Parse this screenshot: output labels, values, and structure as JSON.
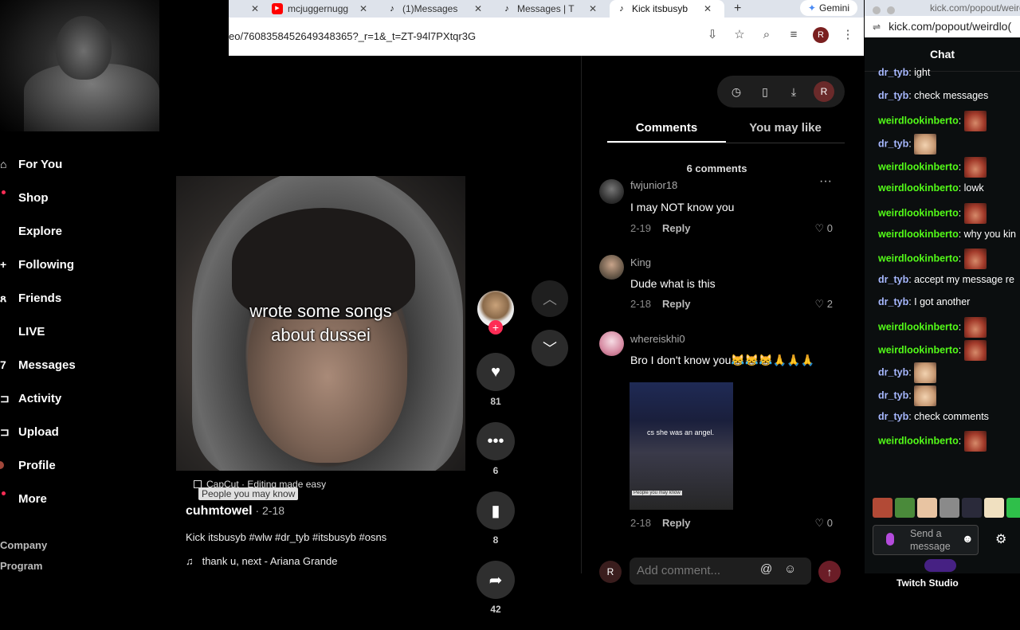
{
  "browser": {
    "tabs": [
      {
        "title": "mcjuggernugg",
        "icon": "youtube-icon"
      },
      {
        "title": "(1)Messages",
        "icon": "tiktok-icon"
      },
      {
        "title": "Messages | T",
        "icon": "tiktok-icon"
      },
      {
        "title": "Kick itsbusyb",
        "icon": "tiktok-icon",
        "active": true
      }
    ],
    "new_tab": "+",
    "gemini_label": "Gemini",
    "url": "eo/7608358452649348365?_r=1&_t=ZT-94l7PXtqr3G",
    "profile_initial": "R"
  },
  "nav": {
    "items": [
      {
        "label": "For You",
        "icon": "home-icon"
      },
      {
        "label": "Shop",
        "icon": "shop-icon",
        "dot": true
      },
      {
        "label": "Explore",
        "icon": "explore-icon"
      },
      {
        "label": "Following",
        "icon": "following-icon"
      },
      {
        "label": "Friends",
        "icon": "friends-icon"
      },
      {
        "label": "LIVE",
        "icon": "live-icon"
      },
      {
        "label": "Messages",
        "icon": "messages-icon"
      },
      {
        "label": "Activity",
        "icon": "activity-icon"
      },
      {
        "label": "Upload",
        "icon": "upload-icon"
      },
      {
        "label": "Profile",
        "icon": "profile-avatar"
      },
      {
        "label": "More",
        "icon": "more-icon",
        "dot": true
      }
    ],
    "footer": [
      "Company",
      "Program"
    ]
  },
  "video": {
    "caption_line1": "wrote some songs",
    "caption_line2": "about dussei",
    "capcut": "CapCut · Editing made easy",
    "people_you_may_know": "People you may know",
    "author": "cuhmtowel",
    "date": " · 2-18",
    "description": "Kick itsbusyb #wlw #dr_tyb #itsbusyb #osns",
    "music": "thank u, next - Ariana Grande"
  },
  "actions": {
    "likes": "81",
    "comments": "6",
    "saves": "8",
    "shares": "42"
  },
  "panel": {
    "tabs": [
      "Comments",
      "You may like"
    ],
    "comment_count": "6 comments",
    "profile_initial": "R",
    "comments": [
      {
        "user": "fwjunior18",
        "text": "I may NOT know you",
        "date": "2-19",
        "reply": "Reply",
        "likes": "0"
      },
      {
        "user": "King",
        "text": "Dude what is this",
        "date": "2-18",
        "reply": "Reply",
        "likes": "2"
      },
      {
        "user": "whereiskhi0",
        "text": "Bro I don't know you😹😹😹🙏🙏🙏",
        "date": "2-18",
        "reply": "Reply",
        "likes": "0",
        "image_caption": "cs she was an angel."
      }
    ],
    "add_comment_placeholder": "Add comment..."
  },
  "kick": {
    "window_title": "kick.com/popout/weirdlo",
    "url": "kick.com/popout/weirdlo(",
    "chat_title": "Chat",
    "messages": [
      {
        "user": "dr_tyb",
        "text": "ight",
        "kind": "tyb"
      },
      {
        "user": "dr_tyb",
        "text": "check messages",
        "kind": "tyb"
      },
      {
        "user": "weirdlookinberto",
        "text": "",
        "kind": "berto",
        "emote": "red"
      },
      {
        "user": "dr_tyb",
        "text": "",
        "kind": "tyb",
        "emote": "face"
      },
      {
        "user": "weirdlookinberto",
        "text": "",
        "kind": "berto",
        "emote": "red"
      },
      {
        "user": "weirdlookinberto",
        "text": "lowk",
        "kind": "berto"
      },
      {
        "user": "weirdlookinberto",
        "text": "",
        "kind": "berto",
        "emote": "red"
      },
      {
        "user": "weirdlookinberto",
        "text": "why you kin",
        "kind": "berto"
      },
      {
        "user": "weirdlookinberto",
        "text": "",
        "kind": "berto",
        "emote": "red"
      },
      {
        "user": "dr_tyb",
        "text": "accept my message re",
        "kind": "tyb"
      },
      {
        "user": "dr_tyb",
        "text": "I got another",
        "kind": "tyb"
      },
      {
        "user": "weirdlookinberto",
        "text": "",
        "kind": "berto",
        "emote": "red"
      },
      {
        "user": "weirdlookinberto",
        "text": "",
        "kind": "berto",
        "emote": "red"
      },
      {
        "user": "dr_tyb",
        "text": "",
        "kind": "tyb",
        "emote": "face"
      },
      {
        "user": "dr_tyb",
        "text": "",
        "kind": "tyb",
        "emote": "face"
      },
      {
        "user": "dr_tyb",
        "text": "check comments",
        "kind": "tyb"
      },
      {
        "user": "weirdlookinberto",
        "text": "",
        "kind": "berto",
        "emote": "red"
      }
    ],
    "send_placeholder_line1": "Send a",
    "send_placeholder_line2": "message",
    "twitch_studio": "Twitch Studio"
  },
  "colors": {
    "tiktok_red": "#fe2c55",
    "kick_green": "#53fc18",
    "tyb_blue": "#a7b8ff"
  }
}
